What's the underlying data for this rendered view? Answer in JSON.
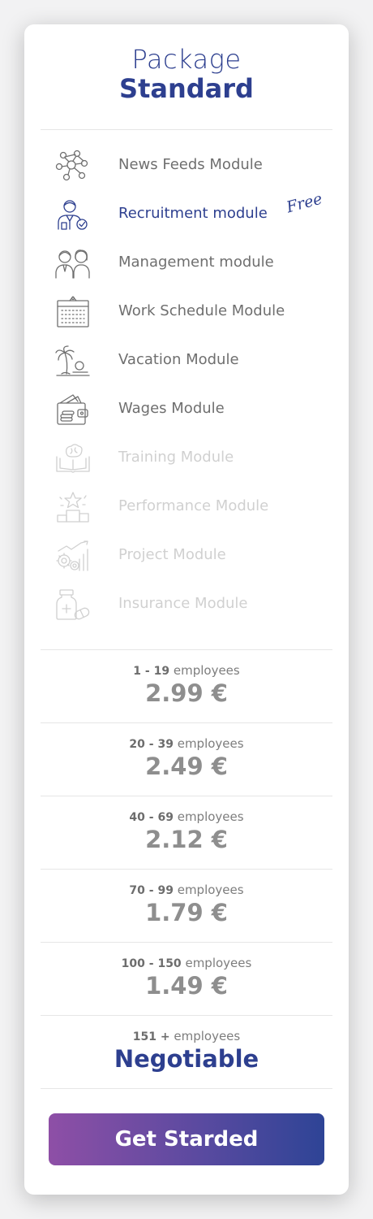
{
  "package": {
    "title": "Package",
    "name": "Standard"
  },
  "modules": [
    {
      "label": "News Feeds Module",
      "icon": "network-nodes-icon",
      "state": "included"
    },
    {
      "label": "Recruitment module",
      "icon": "recruiter-icon",
      "state": "active",
      "badge": "Free"
    },
    {
      "label": "Management module",
      "icon": "team-people-icon",
      "state": "included"
    },
    {
      "label": "Work Schedule Module",
      "icon": "calendar-icon",
      "state": "included"
    },
    {
      "label": "Vacation Module",
      "icon": "palm-beach-icon",
      "state": "included"
    },
    {
      "label": "Wages Module",
      "icon": "wallet-money-icon",
      "state": "included"
    },
    {
      "label": "Training Module",
      "icon": "book-brain-icon",
      "state": "excluded"
    },
    {
      "label": "Performance Module",
      "icon": "podium-star-icon",
      "state": "excluded"
    },
    {
      "label": "Project Module",
      "icon": "gears-chart-icon",
      "state": "excluded"
    },
    {
      "label": "Insurance Module",
      "icon": "medicine-icon",
      "state": "excluded"
    }
  ],
  "pricing": [
    {
      "range": "1 - 19",
      "unit": "employees",
      "price": "2.99 €"
    },
    {
      "range": "20 - 39",
      "unit": "employees",
      "price": "2.49 €"
    },
    {
      "range": "40 - 69",
      "unit": "employees",
      "price": "2.12 €"
    },
    {
      "range": "70 - 99",
      "unit": "employees",
      "price": "1.79 €"
    },
    {
      "range": "100 - 150",
      "unit": "employees",
      "price": "1.49 €"
    },
    {
      "range": "151 +",
      "unit": "employees",
      "price": "Negotiable"
    }
  ],
  "cta": {
    "label": "Get Starded"
  },
  "colors": {
    "primary": "#2d3f8f",
    "gradient_start": "#8e4fa6",
    "gradient_end": "#2e4496",
    "muted_text": "#6f6f6f"
  }
}
